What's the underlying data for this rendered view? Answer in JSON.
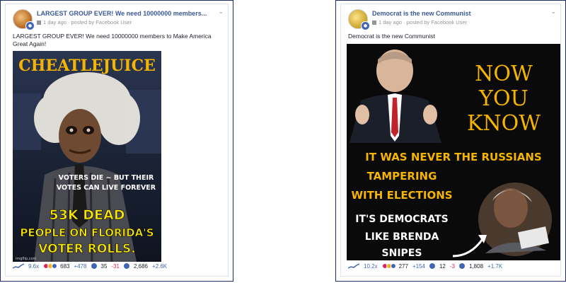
{
  "post1": {
    "group_title": "LARGEST GROUP EVER! We need 10000000 members...",
    "meta": "1 day ago · posted by Facebook User",
    "text": "LARGEST GROUP EVER! We need 10000000 members to Make America Great Again!",
    "meme": {
      "top_text": "CHEATLEJUICE",
      "middle_text_1": "VOTERS DIE ~ BUT THEIR",
      "middle_text_2": "VOTES CAN LIVE FOREVER",
      "bottom_line_1": "53K DEAD",
      "bottom_line_2": "PEOPLE ON FLORIDA'S",
      "bottom_line_3": "VOTER ROLLS.",
      "watermark": "imgflip.com"
    },
    "stats": {
      "score": "9.6x",
      "reactions": "683",
      "reactions_delta": "+478",
      "comments": "35",
      "comments_delta": "-31",
      "shares": "2,686",
      "shares_delta": "+2.6K"
    }
  },
  "post2": {
    "group_title": "Democrat is the new Communist",
    "meta": "1 day ago · posted by Facebook User",
    "text": "Democrat is the new Communist",
    "meme": {
      "headline_1": "NOW",
      "headline_2": "YOU",
      "headline_3": "KNOW",
      "line_1": "IT WAS NEVER THE RUSSIANS",
      "line_2": "TAMPERING",
      "line_3": "WITH ELECTIONS",
      "line_4": "IT'S DEMOCRATS",
      "line_5": "LIKE BRENDA",
      "line_6": "SNIPES"
    },
    "stats": {
      "score": "10.2x",
      "reactions": "277",
      "reactions_delta": "+154",
      "comments": "12",
      "comments_delta": "-3",
      "shares": "1,808",
      "shares_delta": "+1.7K"
    }
  },
  "colors": {
    "link_blue": "#3b5998",
    "meme_yellow": "#f5b400",
    "negative": "#e0245e"
  }
}
